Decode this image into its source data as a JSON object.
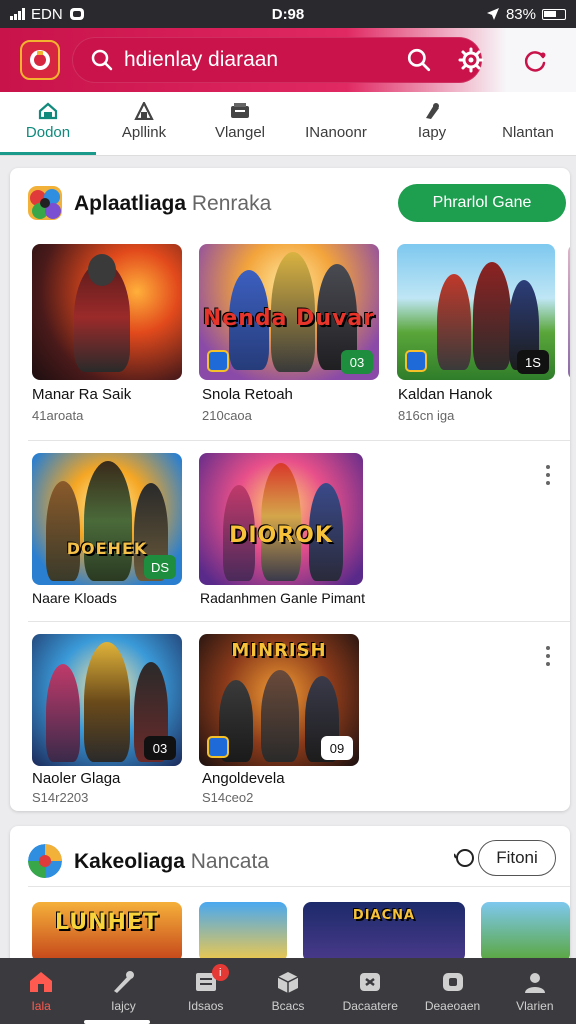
{
  "status_bar": {
    "carrier": "EDN",
    "time": "D:98",
    "battery": "83%"
  },
  "search": {
    "placeholder": "hdienlay diaraan"
  },
  "tabs": [
    {
      "label": "Dodon",
      "icon": "home-icon",
      "active": true
    },
    {
      "label": "Apllink",
      "icon": "apps-icon",
      "active": false
    },
    {
      "label": "Vlangel",
      "icon": "movies-icon",
      "active": false
    },
    {
      "label": "INanoonr",
      "icon": "",
      "active": false
    },
    {
      "label": "Iapy",
      "icon": "books-icon",
      "active": false
    },
    {
      "label": "Nlantan",
      "icon": "",
      "active": false
    }
  ],
  "section1": {
    "title": "Aplaatliaga",
    "subtitle": "Renraka",
    "action_label": "Phrarlol Gane",
    "row1": [
      {
        "name": "Manar Ra Saik",
        "sub": "41aroata",
        "badge": "",
        "art_text": ""
      },
      {
        "name": "Snola Retoah",
        "sub": "210caoa",
        "badge": "03",
        "art_text": "Nenda Duvar"
      },
      {
        "name": "Kaldan Hanok",
        "sub": "816cn iga",
        "badge": "1S",
        "art_text": ""
      }
    ],
    "row2": [
      {
        "name": "Naare Kloads",
        "sub": "",
        "badge": "DS",
        "art_text": "DOEHEK"
      },
      {
        "name": "Radanhmen Ganle Pimant",
        "sub": "",
        "badge": "",
        "art_text": "DIOROK"
      }
    ],
    "row3": [
      {
        "name": "Naoler Glaga",
        "sub": "S14r2203",
        "badge": "03",
        "art_text": ""
      },
      {
        "name": "Angoldevela",
        "sub": "S14ceo2",
        "badge": "09",
        "art_text": "MINRISH"
      }
    ]
  },
  "section2": {
    "title": "Kakeoliaga",
    "subtitle": "Nancata",
    "action_label": "Fitoni",
    "art_texts": [
      "LUNHET",
      "",
      "DIACNA",
      ""
    ]
  },
  "bottom_nav": [
    {
      "label": "Iala",
      "icon": "home-icon",
      "active": true,
      "notification": ""
    },
    {
      "label": "Iajcy",
      "icon": "pen-icon",
      "active": false,
      "notification": ""
    },
    {
      "label": "Idsaos",
      "icon": "list-icon",
      "active": false,
      "notification": "i"
    },
    {
      "label": "Bcacs",
      "icon": "box-icon",
      "active": false,
      "notification": ""
    },
    {
      "label": "Dacaatere",
      "icon": "puzzle-icon",
      "active": false,
      "notification": ""
    },
    {
      "label": "Deaeoaen",
      "icon": "library-icon",
      "active": false,
      "notification": ""
    },
    {
      "label": "Vlarien",
      "icon": "person-icon",
      "active": false,
      "notification": ""
    }
  ],
  "colors": {
    "brand": "#d4145a",
    "accent_green": "#1e9e4f",
    "tab_active": "#0f8a7c",
    "nav_active": "#ff5a4f"
  }
}
